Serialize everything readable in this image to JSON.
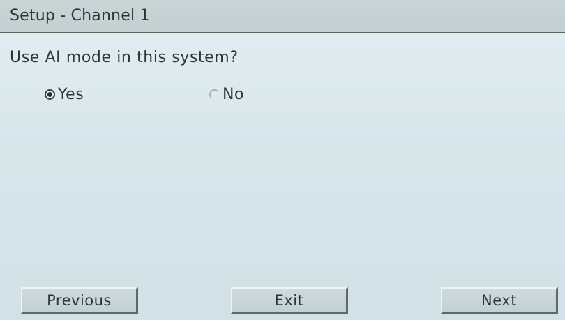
{
  "window": {
    "title": "Setup - Channel 1"
  },
  "main": {
    "question": "Use AI mode in this system?",
    "options": [
      {
        "label": "Yes",
        "selected": true
      },
      {
        "label": "No",
        "selected": false
      }
    ]
  },
  "footer": {
    "previous_label": "Previous",
    "exit_label": "Exit",
    "next_label": "Next"
  },
  "colors": {
    "background": "#d8e6eb",
    "title_bar": "#c6d3d5",
    "title_rule": "#5a6a50",
    "button_face": "#c9d6d9",
    "text": "#2f3438"
  }
}
